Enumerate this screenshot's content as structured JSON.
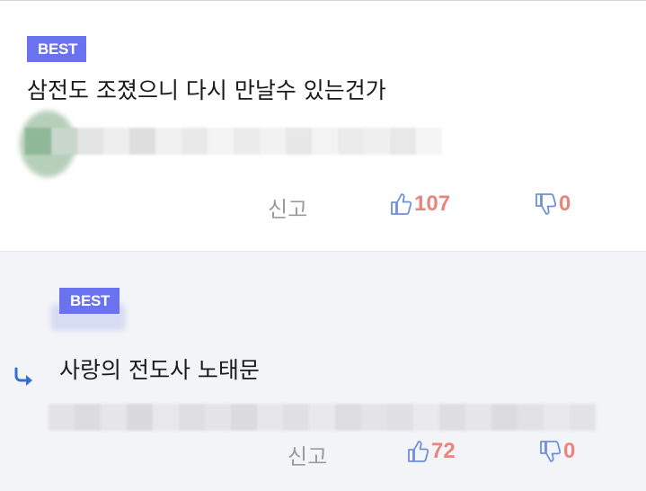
{
  "comments": [
    {
      "badge": "BEST",
      "text": "삼전도 조졌으니 다시 만날수 있는건가",
      "report_label": "신고",
      "upvotes": "107",
      "downvotes": "0"
    },
    {
      "badge": "BEST",
      "text": "사랑의 전도사 노태문",
      "report_label": "신고",
      "upvotes": "72",
      "downvotes": "0"
    }
  ],
  "colors": {
    "badge": "#6b72f0",
    "vote_count": "#e8867d",
    "vote_icon": "#6f8fd9",
    "reply_arrow": "#2f6fd6",
    "reply_background": "#f3f4f7"
  },
  "icons": [
    "thumbs-up-icon",
    "thumbs-down-icon",
    "reply-arrow-icon"
  ]
}
